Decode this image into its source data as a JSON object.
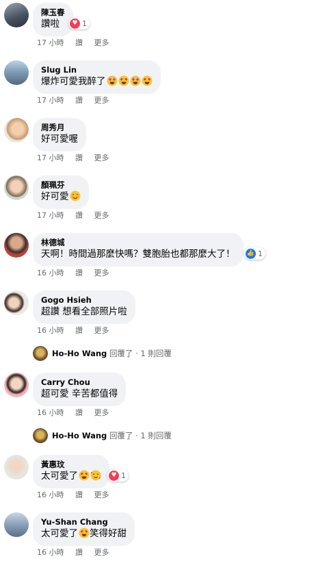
{
  "comments": [
    {
      "name": "陳玉春",
      "text": "讚啦",
      "time": "17 小時",
      "like": "讚",
      "more": "更多",
      "reaction_count": "1"
    },
    {
      "name": "Slug Lin",
      "text": "爆炸可愛我醉了",
      "time": "17 小時",
      "like": "讚",
      "more": "更多"
    },
    {
      "name": "周秀月",
      "text": "好可愛喔",
      "time": "17 小時",
      "like": "讚",
      "more": "更多"
    },
    {
      "name": "顏珮芬",
      "text": "好可愛",
      "time": "17 小時",
      "like": "讚",
      "more": "更多"
    },
    {
      "name": "林德城",
      "text": "天啊！時間過那麼快嗎？雙胞胎也都那麼大了！",
      "time": "16 小時",
      "like": "讚",
      "more": "更多",
      "reaction_count": "1"
    },
    {
      "name": "Gogo Hsieh",
      "text": "超讚 想看全部照片啦",
      "time": "16 小時",
      "like": "讚",
      "more": "更多"
    },
    {
      "name": "Carry Chou",
      "text": "超可愛 辛苦都值得",
      "time": "16 小時",
      "like": "讚",
      "more": "更多"
    },
    {
      "name": "黃惠玟",
      "text": "太可愛了",
      "time": "16 小時",
      "like": "讚",
      "more": "更多",
      "reaction_count": "1"
    },
    {
      "name": "Yu-Shan Chang",
      "text": "太可愛了",
      "text_suffix": "笑得好甜",
      "time": "16 小時",
      "like": "讚",
      "more": "更多"
    }
  ],
  "replies": [
    {
      "name": "Ho-Ho Wang",
      "action": "回覆了",
      "count": "· 1 則回覆"
    },
    {
      "name": "Ho-Ho Wang",
      "action": "回覆了",
      "count": "· 1 則回覆"
    }
  ],
  "icons": {
    "heart": "heart-icon",
    "like": "thumbs-up-icon",
    "star_eyes": "star-struck-emoji",
    "heart_eyes": "heart-eyes-emoji",
    "smile": "smiling-emoji",
    "hearts_face": "smiling-face-with-hearts-emoji"
  },
  "colors": {
    "bubble": "#f0f2f5",
    "meta": "#65676b",
    "heart": "#f33e58",
    "like": "#1877f2"
  }
}
